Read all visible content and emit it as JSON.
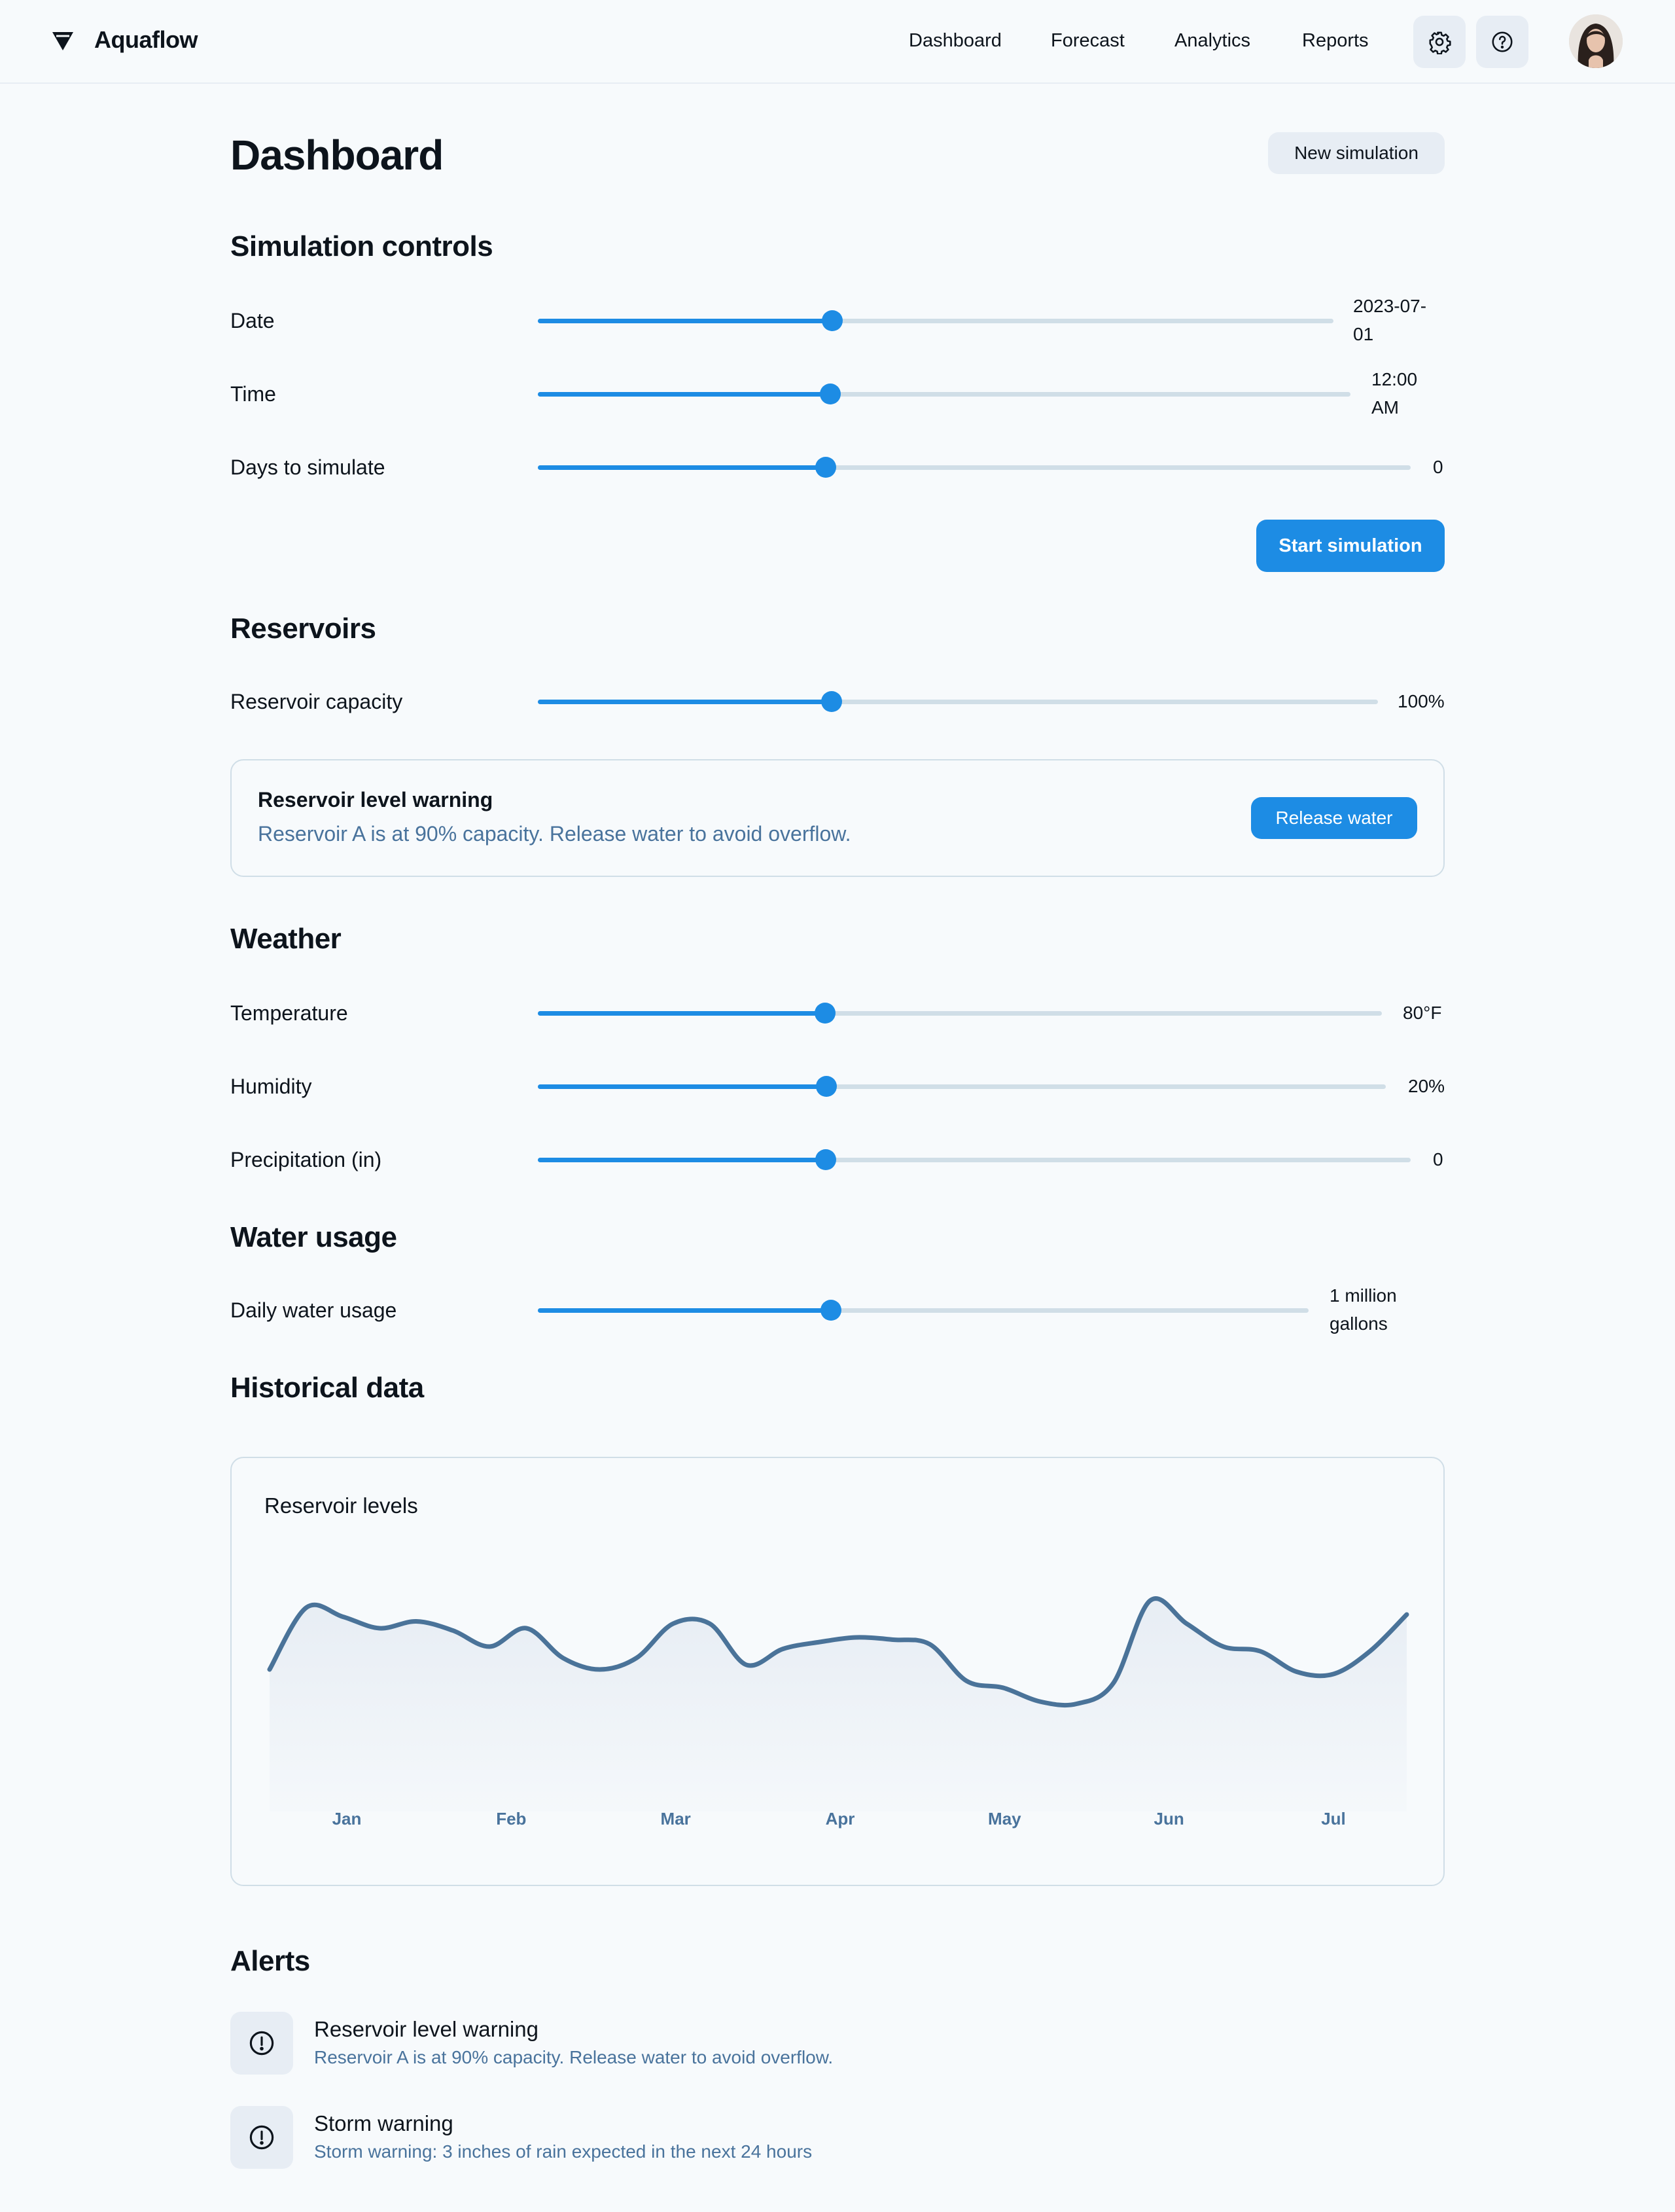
{
  "app": {
    "name": "Aquaflow"
  },
  "nav": {
    "items": [
      {
        "label": "Dashboard"
      },
      {
        "label": "Forecast"
      },
      {
        "label": "Analytics"
      },
      {
        "label": "Reports"
      }
    ],
    "icons": [
      "gear-icon",
      "help-icon"
    ]
  },
  "page": {
    "title": "Dashboard",
    "new_simulation_label": "New simulation"
  },
  "simulation": {
    "title": "Simulation controls",
    "controls": [
      {
        "label": "Date",
        "value": "2023-07-\n01",
        "level": 0.37
      },
      {
        "label": "Time",
        "value": "12:00\nAM",
        "level": 0.36
      },
      {
        "label": "Days to simulate",
        "value": "0",
        "level": 0.33
      }
    ],
    "start_label": "Start simulation"
  },
  "reservoirs": {
    "title": "Reservoirs",
    "controls": [
      {
        "label": "Reservoir capacity",
        "value": "100%",
        "level": 0.35
      }
    ],
    "warning": {
      "title": "Reservoir level warning",
      "text": "Reservoir A is at 90% capacity. Release water to avoid overflow.",
      "action_label": "Release water"
    }
  },
  "weather": {
    "title": "Weather",
    "controls": [
      {
        "label": "Temperature",
        "value": "80°F",
        "level": 0.34
      },
      {
        "label": "Humidity",
        "value": "20%",
        "level": 0.34
      },
      {
        "label": "Precipitation (in)",
        "value": "0",
        "level": 0.33
      }
    ]
  },
  "water_usage": {
    "title": "Water usage",
    "controls": [
      {
        "label": "Daily water usage",
        "value": "1 million\ngallons",
        "level": 0.38
      }
    ]
  },
  "historical": {
    "title": "Historical data",
    "chart_title": "Reservoir levels"
  },
  "chart_data": {
    "type": "area",
    "title": "Reservoir levels",
    "categories": [
      "Jan",
      "Feb",
      "Mar",
      "Apr",
      "May",
      "Jun",
      "Jul"
    ],
    "series": [
      {
        "values": [
          0.62,
          0.89,
          0.85,
          0.8,
          0.83,
          0.79,
          0.72,
          0.8,
          0.67,
          0.62,
          0.67,
          0.82,
          0.82,
          0.64,
          0.71,
          0.74,
          0.76,
          0.75,
          0.73,
          0.57,
          0.54,
          0.48,
          0.47,
          0.56,
          0.92,
          0.82,
          0.72,
          0.7,
          0.61,
          0.6,
          0.7,
          0.86
        ]
      }
    ],
    "colors": {
      "line": "#4a7399",
      "fill": "#e7edf4"
    },
    "grid": false
  },
  "alerts": {
    "title": "Alerts",
    "items": [
      {
        "title": "Reservoir level warning",
        "text": "Reservoir A is at 90% capacity. Release water to avoid overflow."
      },
      {
        "title": "Storm warning",
        "text": "Storm warning: 3 inches of rain expected in the next 24 hours"
      }
    ]
  },
  "colors": {
    "accent": "#1d8ce4",
    "muted_text": "#49739c",
    "surface": "#e7edf4",
    "background": "#f7fafc"
  }
}
